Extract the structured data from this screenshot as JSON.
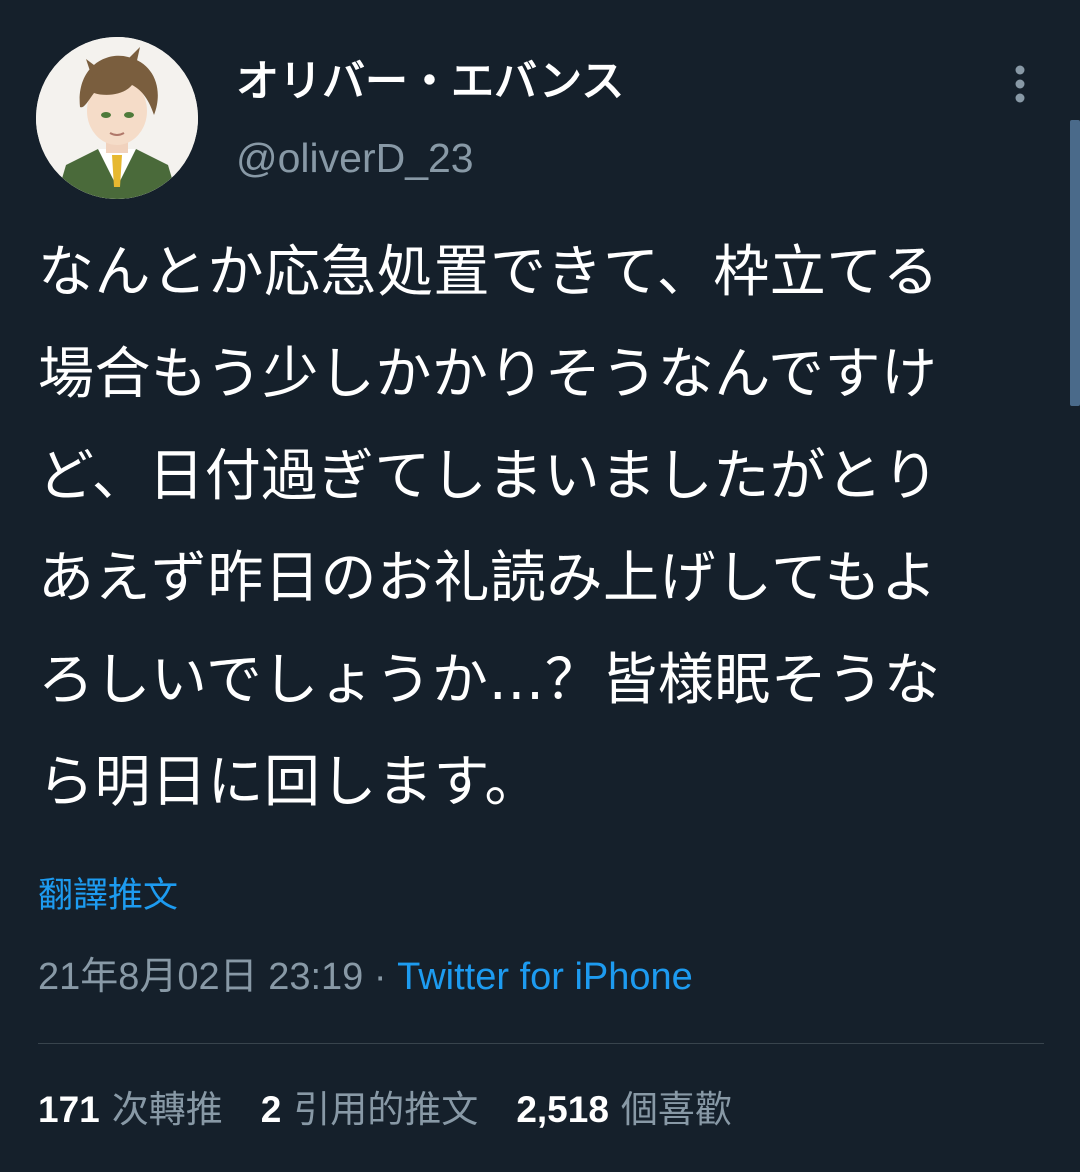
{
  "author": {
    "display_name": "オリバー・エバンス",
    "handle": "@oliverD_23",
    "avatar_icon": "user-avatar-illustration"
  },
  "tweet": {
    "lines": [
      "なんとか応急処置できて、枠立てる",
      "場合もう少しかかりそうなんですけ",
      "ど、日付過ぎてしまいましたがとり",
      "あえず昨日のお礼読み上げしてもよ",
      "ろしいでしょうか…？皆様眠そうな",
      "ら明日に回します。"
    ],
    "translate_label": "翻譯推文",
    "timestamp": "21年8月02日 23:19",
    "separator": " · ",
    "source": "Twitter for iPhone"
  },
  "stats": {
    "retweets": {
      "count": "171",
      "label": "次轉推"
    },
    "quotes": {
      "count": "2",
      "label": "引用的推文"
    },
    "likes": {
      "count": "2,518",
      "label": "個喜歡"
    }
  },
  "icons": {
    "more": "more-vertical-icon"
  },
  "colors": {
    "background": "#15202b",
    "link": "#1d9bf0",
    "secondary_text": "#8899a6"
  }
}
